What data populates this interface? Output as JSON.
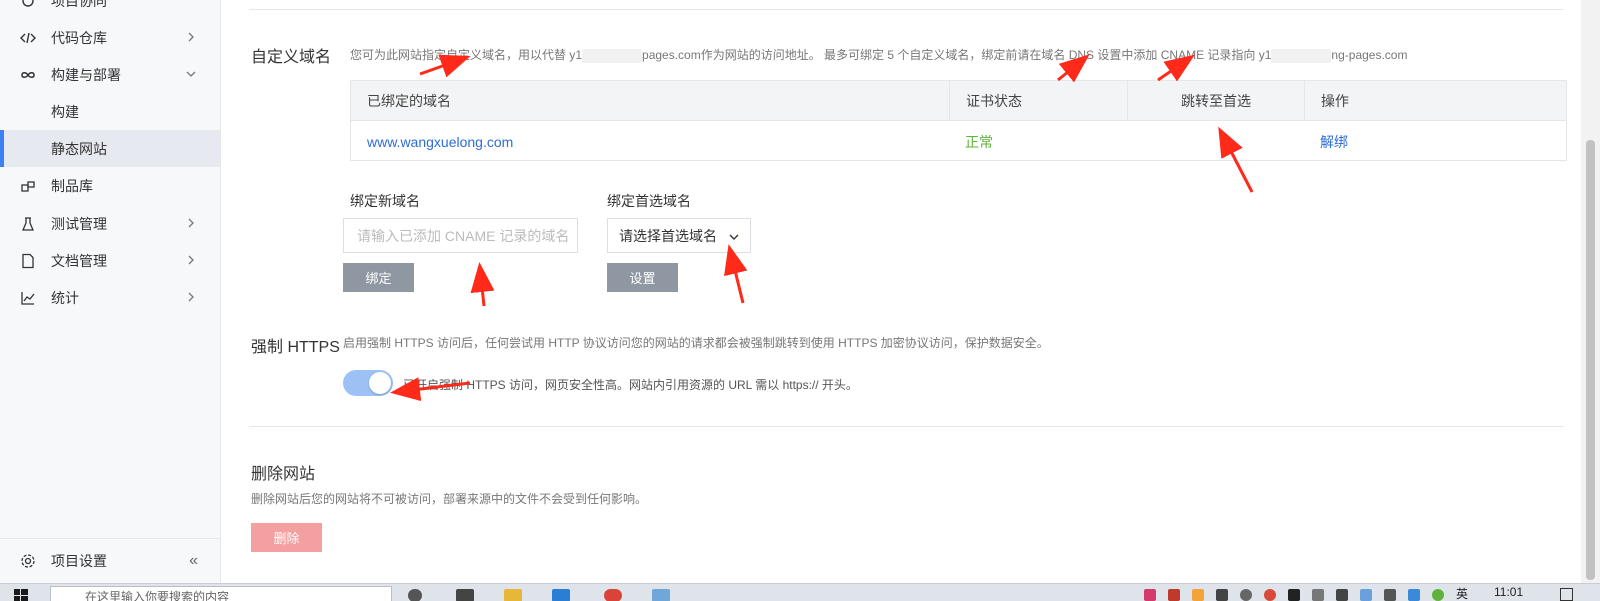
{
  "sidebar": {
    "items": [
      {
        "label": "项目协同",
        "icon": "collab-icon",
        "has_chevron": false
      },
      {
        "label": "代码仓库",
        "icon": "code-icon",
        "has_chevron": true
      },
      {
        "label": "构建与部署",
        "icon": "infinity-icon",
        "has_chevron": true,
        "expanded": true
      },
      {
        "label": "构建",
        "sub": true
      },
      {
        "label": "静态网站",
        "sub": true,
        "active": true
      },
      {
        "label": "制品库",
        "icon": "package-icon",
        "has_chevron": false
      },
      {
        "label": "测试管理",
        "icon": "flask-icon",
        "has_chevron": true
      },
      {
        "label": "文档管理",
        "icon": "document-icon",
        "has_chevron": true
      },
      {
        "label": "统计",
        "icon": "chart-icon",
        "has_chevron": true
      }
    ],
    "settings_label": "项目设置",
    "collapse_glyph": "«"
  },
  "custom_domain": {
    "title": "自定义域名",
    "desc_part1": "您可为此网站指定自定义域名，用以代替 y1",
    "desc_part2": "pages.com作为网站的访问地址。 最多可绑定 5 个自定义域名，绑定前请在域名 DNS 设置中添加 CNAME 记录指向 y1",
    "desc_part3": "ng-pages.com",
    "table": {
      "headers": [
        "已绑定的域名",
        "证书状态",
        "跳转至首选",
        "操作"
      ],
      "rows": [
        {
          "domain": "www.wangxuelong.com",
          "cert_status": "正常",
          "redirect": "",
          "action": "解绑"
        }
      ]
    },
    "bind_new_label": "绑定新域名",
    "bind_new_placeholder": "请输入已添加 CNAME 记录的域名",
    "bind_button": "绑定",
    "preferred_label": "绑定首选域名",
    "preferred_select": "请选择首选域名",
    "set_button": "设置"
  },
  "https": {
    "title": "强制 HTTPS",
    "desc": "启用强制 HTTPS 访问后，任何尝试用 HTTP 协议访问您的网站的请求都会被强制跳转到使用 HTTPS 加密协议访问，保护数据安全。",
    "toggle_on": true,
    "toggle_text": "已开启强制 HTTPS 访问，网页安全性高。网站内引用资源的 URL 需以 https:// 开头。"
  },
  "delete_site": {
    "title": "删除网站",
    "desc": "删除网站后您的网站将不可被访问，部署来源中的文件不会受到任何影响。",
    "button": "删除"
  },
  "taskbar": {
    "search_placeholder": "在这里输入你要搜索的内容",
    "time": "11:01",
    "ime_label": "英"
  },
  "colors": {
    "accent": "#3d7ff5",
    "link": "#2e6cd9",
    "success": "#5fb23a",
    "danger_button": "#f5a0a0",
    "annotation_arrow": "#ff2a1a"
  }
}
